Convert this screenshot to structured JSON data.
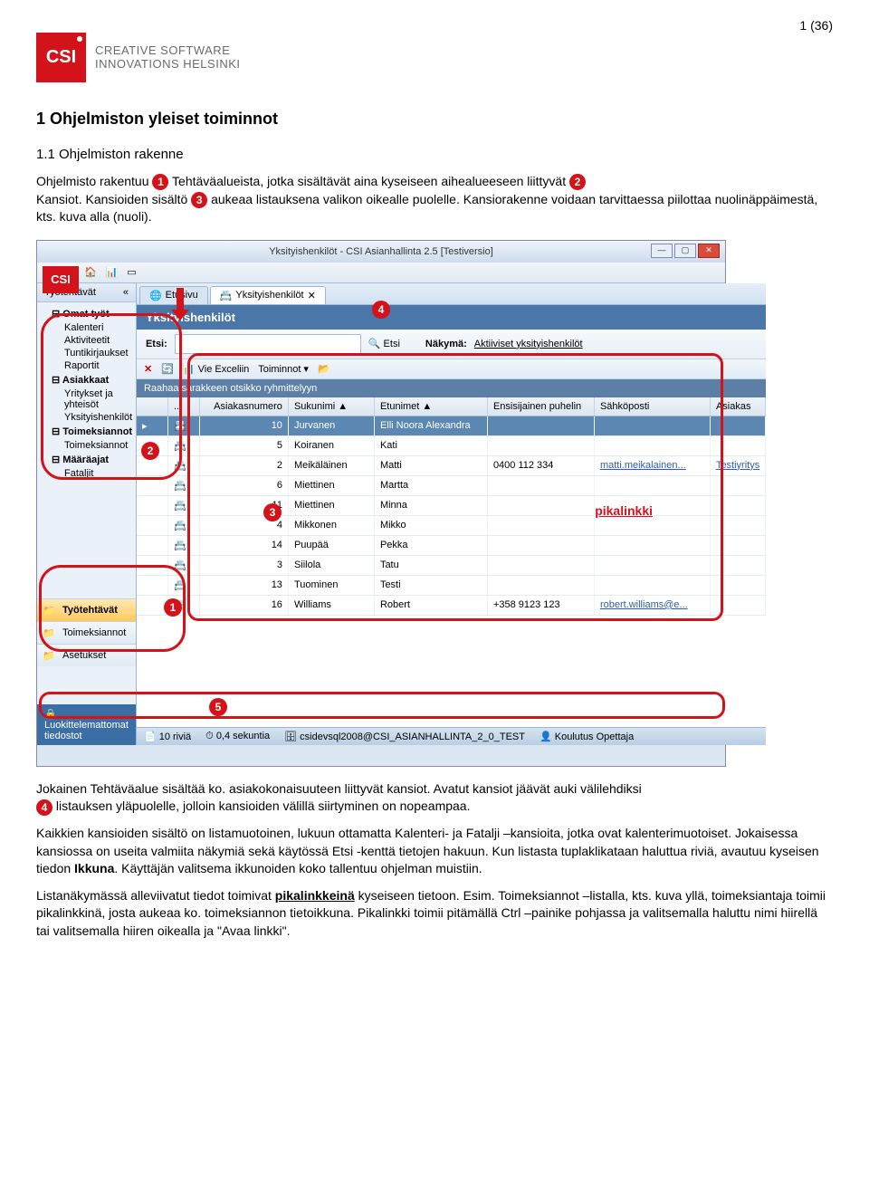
{
  "pageNumber": "1 (36)",
  "logo": {
    "badge": "CSI",
    "line1": "CREATIVE SOFTWARE",
    "line2": "INNOVATIONS HELSINKI"
  },
  "h1": "1   Ohjelmiston yleiset toiminnot",
  "h2": "1.1   Ohjelmiston rakenne",
  "intro": {
    "p1a": "Ohjelmisto rakentuu ",
    "p1b": " Tehtäväalueista, jotka sisältävät aina kyseiseen aihealueeseen liittyvät ",
    "p1c": " Kansiot. Kansioiden sisältö ",
    "p1d": " aukeaa listauksena valikon oikealle puolelle. Kansiorakenne voidaan tarvittaessa piilottaa nuolinäppäimestä, kts. kuva alla (nuoli)."
  },
  "win": {
    "title": "Yksityishenkilöt - CSI Asianhallinta 2.5 [Testiversio]",
    "sideHeader": "Työtehtävät",
    "tree": {
      "g1": "Omat työt",
      "g1i": [
        "Kalenteri",
        "Aktiviteetit",
        "Tuntikirjaukset",
        "Raportit"
      ],
      "g2": "Asiakkaat",
      "g2i": [
        "Yritykset ja yhteisöt",
        "Yksityishenkilöt"
      ],
      "g3": "Toimeksiannot",
      "g3i": [
        "Toimeksiannot"
      ],
      "g4": "Määräajat",
      "g4i": [
        "Fataljit"
      ]
    },
    "nav": [
      "Työtehtävät",
      "Toimeksiannot",
      "Asetukset"
    ],
    "luokit": "Luokittelemattomat tiedostot",
    "tabs": [
      "Etusivu",
      "Yksityishenkilöt"
    ],
    "mainTitle": "Yksityishenkilöt",
    "search": {
      "label": "Etsi:",
      "btn": "Etsi",
      "viewLabel": "Näkymä:",
      "viewVal": "Aktiiviset yksityishenkilöt"
    },
    "toolbar": [
      "✕",
      "Vie Exceliin",
      "Toiminnot ▾"
    ],
    "groupHint": "Raahaa sarakkeen otsikko ryhmittelyyn",
    "cols": [
      "",
      "...",
      "Asiakasnumero",
      "Sukunimi",
      "Etunimet",
      "Ensisijainen puhelin",
      "Sähköposti",
      "Asiakas"
    ],
    "rows": [
      {
        "n": "10",
        "s": "Jurvanen",
        "e": "Elli Noora Alexandra",
        "p": "",
        "m": "",
        "a": ""
      },
      {
        "n": "5",
        "s": "Koiranen",
        "e": "Kati",
        "p": "",
        "m": "",
        "a": ""
      },
      {
        "n": "2",
        "s": "Meikäläinen",
        "e": "Matti",
        "p": "0400 112 334",
        "m": "matti.meikalainen...",
        "a": "Testiyritys"
      },
      {
        "n": "6",
        "s": "Miettinen",
        "e": "Martta",
        "p": "",
        "m": "",
        "a": ""
      },
      {
        "n": "11",
        "s": "Miettinen",
        "e": "Minna",
        "p": "",
        "m": "",
        "a": ""
      },
      {
        "n": "4",
        "s": "Mikkonen",
        "e": "Mikko",
        "p": "",
        "m": "",
        "a": ""
      },
      {
        "n": "14",
        "s": "Puupää",
        "e": "Pekka",
        "p": "",
        "m": "",
        "a": ""
      },
      {
        "n": "3",
        "s": "Siilola",
        "e": "Tatu",
        "p": "",
        "m": "",
        "a": ""
      },
      {
        "n": "13",
        "s": "Tuominen",
        "e": "Testi",
        "p": "",
        "m": "",
        "a": ""
      },
      {
        "n": "16",
        "s": "Williams",
        "e": "Robert",
        "p": "+358 9123 123",
        "m": "robert.williams@e...",
        "a": ""
      }
    ],
    "status": [
      "10 riviä",
      "0,4 sekuntia",
      "csidevsql2008@CSI_ASIANHALLINTA_2_0_TEST",
      "Koulutus Opettaja"
    ],
    "pikalinkki": "pikalinkki"
  },
  "after": {
    "p2a": "Jokainen Tehtäväalue sisältää ko. asiakokonaisuuteen liittyvät kansiot. Avatut kansiot jäävät auki välilehdiksi ",
    "p2b": " listauksen yläpuolelle, jolloin kansioiden välillä siirtyminen on nopeampaa.",
    "p3": "Kaikkien kansioiden sisältö on listamuotoinen, lukuun ottamatta Kalenteri- ja Fatalji –kansioita, jotka ovat kalenterimuotoiset. Jokaisessa kansiossa on useita valmiita näkymiä sekä käytössä Etsi -kenttä tietojen hakuun. Kun listasta tuplaklikataan haluttua riviä, avautuu kyseisen tiedon ",
    "p3b": "Ikkuna",
    "p3c": ". Käyttäjän valitsema ikkunoiden koko tallentuu ohjelman muistiin.",
    "p4a": "Listanäkymässä alleviivatut tiedot toimivat ",
    "p4link": "pikalinkkeinä",
    "p4b": " kyseiseen tietoon. Esim. Toimeksiannot –listalla, kts. kuva yllä, toimeksiantaja toimii pikalinkkinä, josta aukeaa ko. toimeksiannon tietoikkuna. Pikalinkki toimii pitämällä Ctrl –painike pohjassa ja valitsemalla haluttu nimi hiirellä tai valitsemalla hiiren oikealla ja \"Avaa linkki\"."
  }
}
